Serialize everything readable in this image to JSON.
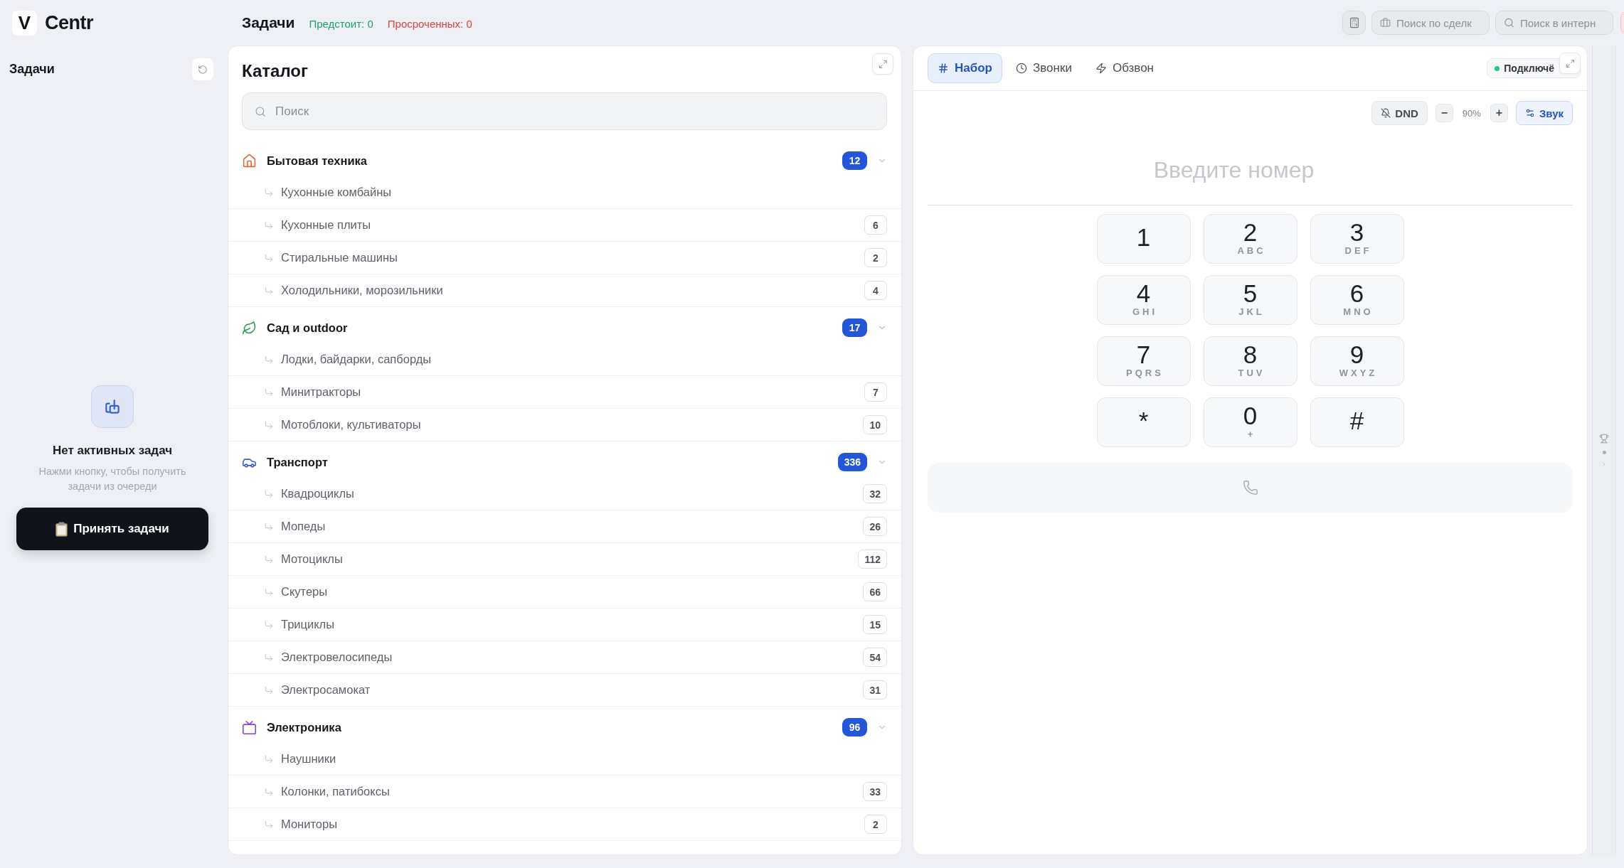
{
  "app": {
    "logo_mark": "V",
    "name": "Centr"
  },
  "header": {
    "title": "Задачи",
    "upcoming": "Предстоит: 0",
    "overdue": "Просроченных: 0",
    "deal_search": {
      "placeholder": "Поиск по сделк"
    },
    "web_search": {
      "placeholder": "Поиск в интерн"
    }
  },
  "sidebar": {
    "title": "Задачи",
    "empty_state": {
      "title": "Нет активных задач",
      "text": "Нажми кнопку, чтобы получить задачи из очереди",
      "button": "Принять задачи"
    }
  },
  "catalog": {
    "title": "Каталог",
    "search": {
      "placeholder": "Поиск"
    },
    "categories": [
      {
        "name": "Бытовая техника",
        "count": "12",
        "color": "#e0662c",
        "expanded": true,
        "children": [
          {
            "name": "Кухонные комбайны"
          },
          {
            "name": "Кухонные плиты",
            "count": "6"
          },
          {
            "name": "Стиральные машины",
            "count": "2"
          },
          {
            "name": "Холодильники, морозильники",
            "count": "4"
          }
        ]
      },
      {
        "name": "Сад и outdoor",
        "count": "17",
        "color": "#2f9a4c",
        "expanded": true,
        "children": [
          {
            "name": "Лодки, байдарки, сапборды"
          },
          {
            "name": "Минитракторы",
            "count": "7"
          },
          {
            "name": "Мотоблоки, культиваторы",
            "count": "10"
          }
        ]
      },
      {
        "name": "Транспорт",
        "count": "336",
        "color": "#2f5fd0",
        "expanded": true,
        "children": [
          {
            "name": "Квадроциклы",
            "count": "32"
          },
          {
            "name": "Мопеды",
            "count": "26"
          },
          {
            "name": "Мотоциклы",
            "count": "112"
          },
          {
            "name": "Скутеры",
            "count": "66"
          },
          {
            "name": "Трициклы",
            "count": "15"
          },
          {
            "name": "Электровелосипеды",
            "count": "54"
          },
          {
            "name": "Электросамокат",
            "count": "31"
          }
        ]
      },
      {
        "name": "Электроника",
        "count": "96",
        "color": "#8a3fd6",
        "expanded": true,
        "children": [
          {
            "name": "Наушники"
          },
          {
            "name": "Колонки, патибоксы",
            "count": "33"
          },
          {
            "name": "Мониторы",
            "count": "2"
          }
        ]
      }
    ]
  },
  "phone": {
    "tabs": [
      {
        "label": "Набор",
        "selected": true
      },
      {
        "label": "Звонки",
        "selected": false
      },
      {
        "label": "Обзвон",
        "selected": false
      }
    ],
    "status": {
      "label": "Подключё",
      "connected": true
    },
    "dnd": "DND",
    "volume": {
      "minus": "−",
      "value": "90%",
      "plus": "+"
    },
    "sound": "Звук",
    "number": {
      "placeholder": "Введите номер"
    },
    "keys": [
      {
        "digit": "1"
      },
      {
        "digit": "2",
        "letters": "ABC"
      },
      {
        "digit": "3",
        "letters": "DEF"
      },
      {
        "digit": "4",
        "letters": "GHI"
      },
      {
        "digit": "5",
        "letters": "JKL"
      },
      {
        "digit": "6",
        "letters": "MNO"
      },
      {
        "digit": "7",
        "letters": "PQRS"
      },
      {
        "digit": "8",
        "letters": "TUV"
      },
      {
        "digit": "9",
        "letters": "WXYZ"
      },
      {
        "digit": "*"
      },
      {
        "digit": "0",
        "letters": "+"
      },
      {
        "digit": "#"
      }
    ],
    "call": {
      "disabled": true
    }
  }
}
